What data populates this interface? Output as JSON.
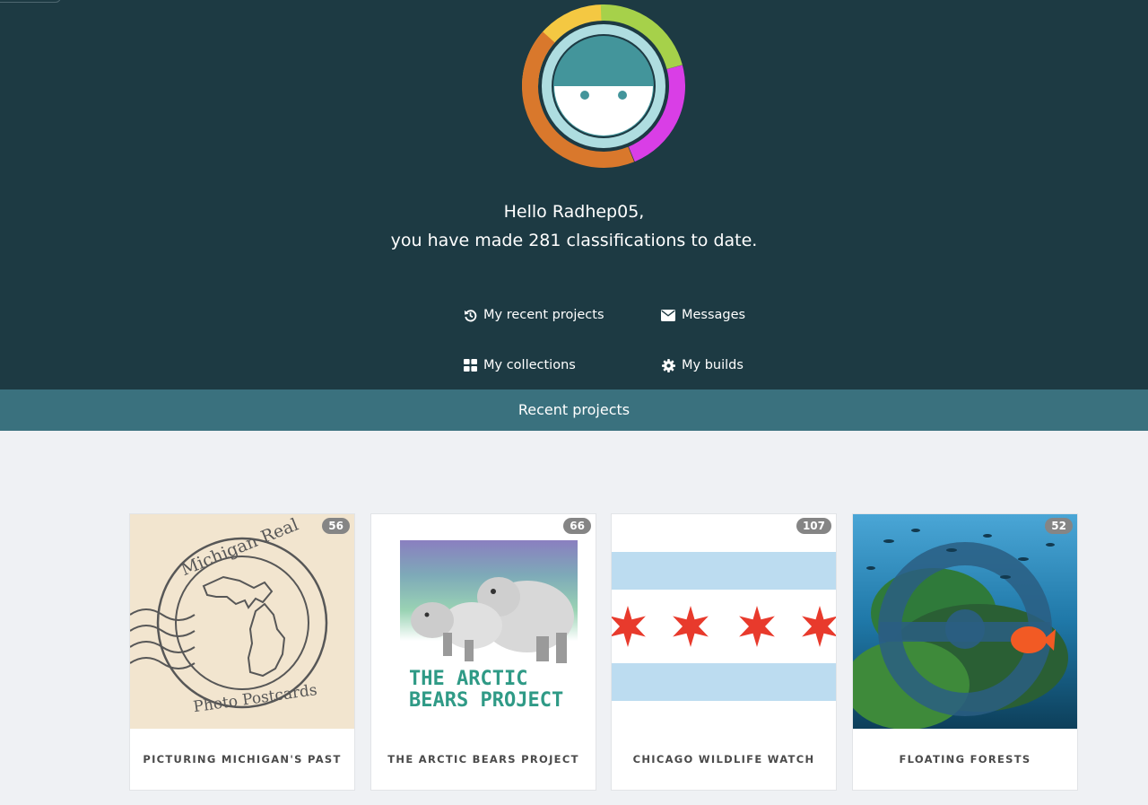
{
  "user": {
    "greeting_line1": "Hello Radhep05,",
    "greeting_line2": "you have made 281 classifications to date."
  },
  "nav": {
    "recent_projects": "My recent projects",
    "messages": "Messages",
    "collections": "My collections",
    "builds": "My builds"
  },
  "section": {
    "title": "Recent projects"
  },
  "projects": [
    {
      "name": "PICTURING MICHIGAN'S PAST",
      "count": "56",
      "stamp_text_top": "Michigan Real",
      "stamp_text_bottom": "Photo Postcards"
    },
    {
      "name": "THE ARCTIC BEARS PROJECT",
      "count": "66",
      "logo_line1": "THE ARCTIC",
      "logo_line2": "BEARS PROJECT"
    },
    {
      "name": "CHICAGO WILDLIFE WATCH",
      "count": "107"
    },
    {
      "name": "FLOATING FORESTS",
      "count": "52"
    }
  ],
  "colors": {
    "hero_bg": "#1d3a43",
    "band_bg": "#3a717e",
    "page_bg": "#eff1f4",
    "badge_bg": "#858585",
    "ring": [
      "#f4c842",
      "#a6d14a",
      "#d93ee6",
      "#d9782c"
    ]
  }
}
